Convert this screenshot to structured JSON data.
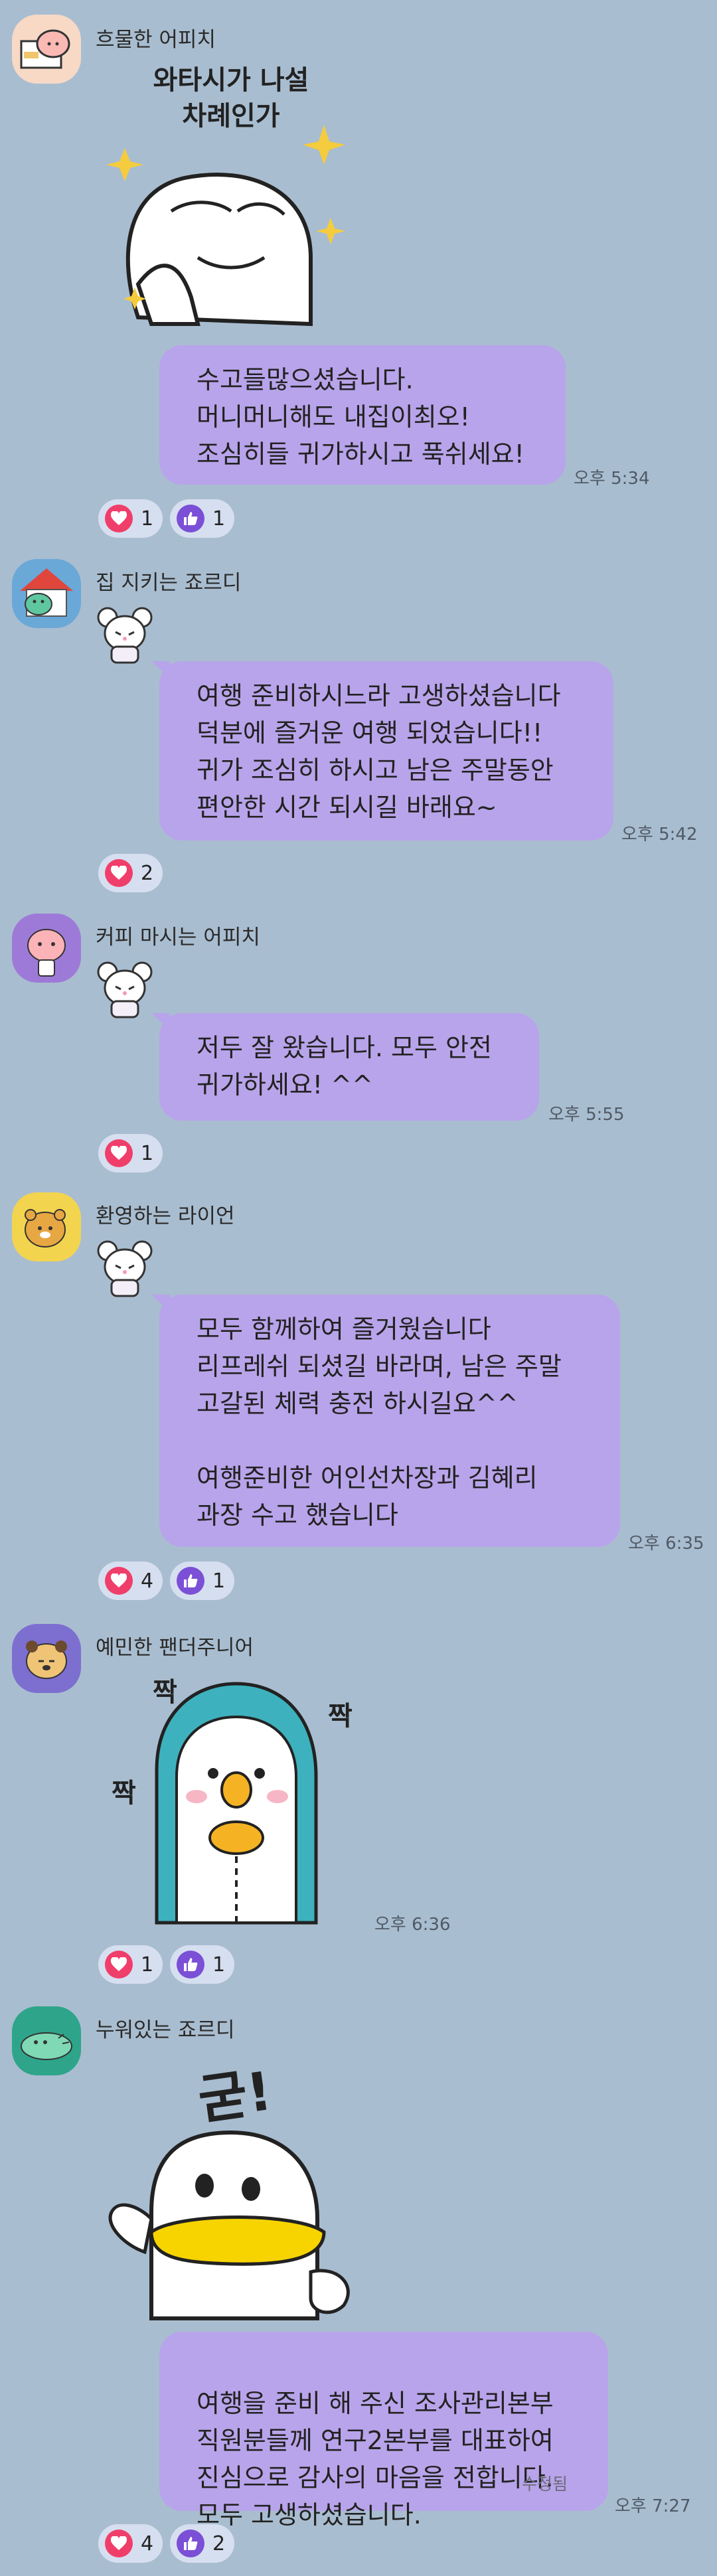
{
  "messages": [
    {
      "sender": "흐물한 어피치",
      "sticker_text": "와타시가 나설\n차례인가",
      "text": "수고들많으셨습니다.\n머니머니해도 내집이최오!\n조심히들 귀가하시고 푹쉬세요!",
      "time": "오후 5:34",
      "reactions": [
        {
          "type": "heart",
          "count": "1"
        },
        {
          "type": "like",
          "count": "1"
        }
      ]
    },
    {
      "sender": "집 지키는 죠르디",
      "text": "여행 준비하시느라 고생하셨습니다\n덕분에 즐거운 여행 되었습니다!!\n귀가 조심히 하시고 남은 주말동안\n편안한 시간 되시길 바래요~",
      "time": "오후 5:42",
      "reactions": [
        {
          "type": "heart",
          "count": "2"
        }
      ]
    },
    {
      "sender": "커피 마시는 어피치",
      "text": "저두 잘 왔습니다. 모두 안전\n귀가하세요! ^^",
      "time": "오후 5:55",
      "reactions": [
        {
          "type": "heart",
          "count": "1"
        }
      ]
    },
    {
      "sender": "환영하는 라이언",
      "text": "모두 함께하여 즐거웠습니다\n리프레쉬 되셨길 바라며, 남은 주말\n고갈된 체력 충전 하시길요^^\n\n여행준비한 어인선차장과 김혜리\n과장 수고 했습니다",
      "time": "오후 6:35",
      "reactions": [
        {
          "type": "heart",
          "count": "4"
        },
        {
          "type": "like",
          "count": "1"
        }
      ]
    },
    {
      "sender": "예민한 팬더주니어",
      "sticker_text": [
        "짝",
        "짝",
        "짝"
      ],
      "time": "오후 6:36",
      "reactions": [
        {
          "type": "heart",
          "count": "1"
        },
        {
          "type": "like",
          "count": "1"
        }
      ]
    },
    {
      "sender": "누워있는 죠르디",
      "sticker_text": "굳!",
      "text": "여행을 준비 해 주신 조사관리본부\n직원분들께 연구2본부를 대표하여\n진심으로 감사의 마음을 전합니다.\n모두 고생하셨습니다.",
      "edited": "수정됨",
      "time": "오후 7:27",
      "reactions": [
        {
          "type": "heart",
          "count": "4"
        },
        {
          "type": "like",
          "count": "2"
        }
      ]
    }
  ],
  "icons": {
    "heart": "heart-icon",
    "like": "thumbs-up-icon"
  },
  "colors": {
    "background": "#a9bdd0",
    "bubble": "#b8a4ea",
    "heart": "#f03e6a",
    "like": "#7b4fd6"
  }
}
